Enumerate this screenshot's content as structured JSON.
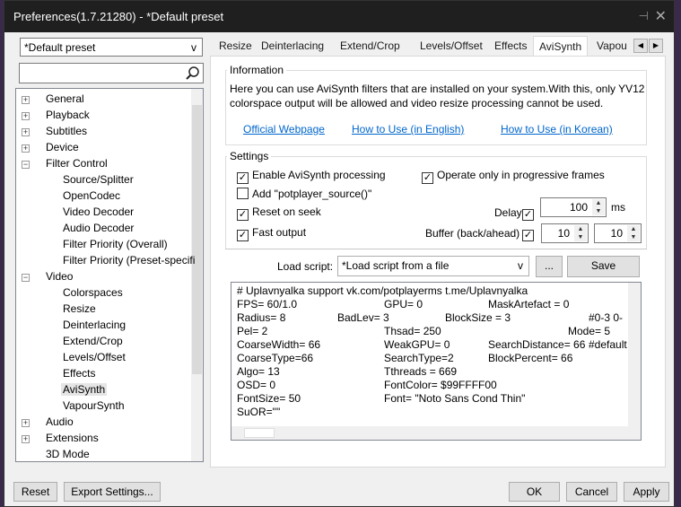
{
  "title": "Preferences(1.7.21280) - *Default preset",
  "preset": "*Default preset",
  "search_placeholder": "",
  "tree": [
    {
      "label": "General",
      "level": 0,
      "exp": "+"
    },
    {
      "label": "Playback",
      "level": 0,
      "exp": "+"
    },
    {
      "label": "Subtitles",
      "level": 0,
      "exp": "+"
    },
    {
      "label": "Device",
      "level": 0,
      "exp": "+"
    },
    {
      "label": "Filter Control",
      "level": 0,
      "exp": "-"
    },
    {
      "label": "Source/Splitter",
      "level": 1
    },
    {
      "label": "OpenCodec",
      "level": 1
    },
    {
      "label": "Video Decoder",
      "level": 1
    },
    {
      "label": "Audio Decoder",
      "level": 1
    },
    {
      "label": "Filter Priority (Overall)",
      "level": 1
    },
    {
      "label": "Filter Priority (Preset-specifi",
      "level": 1
    },
    {
      "label": "Video",
      "level": 0,
      "exp": "-"
    },
    {
      "label": "Colorspaces",
      "level": 1
    },
    {
      "label": "Resize",
      "level": 1
    },
    {
      "label": "Deinterlacing",
      "level": 1
    },
    {
      "label": "Extend/Crop",
      "level": 1
    },
    {
      "label": "Levels/Offset",
      "level": 1
    },
    {
      "label": "Effects",
      "level": 1
    },
    {
      "label": "AviSynth",
      "level": 1,
      "selected": true
    },
    {
      "label": "VapourSynth",
      "level": 1
    },
    {
      "label": "Audio",
      "level": 0,
      "exp": "+"
    },
    {
      "label": "Extensions",
      "level": 0,
      "exp": "+"
    },
    {
      "label": "3D Mode",
      "level": 0
    }
  ],
  "tabs": [
    "Resize",
    "Deinterlacing",
    "Extend/Crop",
    "Levels/Offset",
    "Effects",
    "AviSynth",
    "Vapou"
  ],
  "active_tab": "AviSynth",
  "info": {
    "label": "Information",
    "line1": "Here you can use AviSynth filters that are installed on your system.With this, only YV12",
    "line2": "colorspace output will be allowed and video resize processing cannot be used.",
    "links": [
      "Official Webpage",
      "How to Use (in English)",
      "How to Use (in Korean)"
    ]
  },
  "settings": {
    "label": "Settings",
    "enable": {
      "label": "Enable AviSynth processing",
      "checked": true
    },
    "progressive": {
      "label": "Operate only in progressive frames",
      "checked": true
    },
    "add_source": {
      "label": "Add \"potplayer_source()\"",
      "checked": false
    },
    "reset": {
      "label": "Reset on seek",
      "checked": true
    },
    "fast": {
      "label": "Fast output",
      "checked": true
    },
    "delay": {
      "label": "Delay",
      "checked": true,
      "value": "100",
      "unit": "ms"
    },
    "buffer": {
      "label": "Buffer (back/ahead)",
      "checked": true,
      "back": "10",
      "ahead": "10"
    }
  },
  "load_script": {
    "label": "Load script:",
    "value": "*Load script from a file",
    "browse": "...",
    "save": "Save"
  },
  "script_lines": [
    [
      "# Uplavnyalka support vk.com/potplayerms t.me/Uplavnyalka"
    ],
    [
      "FPS= 60/1.0",
      "GPU= 0",
      "MaskArtefact = 0"
    ],
    [
      "Radius= 8",
      "BadLev= 3",
      "BlockSize = 3",
      "#0-3  0-"
    ],
    [
      "Pel= 2",
      "Thsad= 250",
      "Mode= 5"
    ],
    [
      "CoarseWidth= 66",
      "WeakGPU= 0",
      "SearchDistance= 66",
      "#default"
    ],
    [
      "CoarseType=66",
      "SearchType=2",
      "BlockPercent= 66"
    ],
    [
      "Algo= 13",
      "Tthreads = 669"
    ],
    [
      "OSD= 0",
      "FontColor= $99FFFF00"
    ],
    [
      "FontSize= 50",
      "Font= \"Noto Sans Cond Thin\""
    ],
    [
      "SuOR=\"\""
    ]
  ],
  "buttons": {
    "reset": "Reset",
    "export": "Export Settings...",
    "ok": "OK",
    "cancel": "Cancel",
    "apply": "Apply"
  }
}
